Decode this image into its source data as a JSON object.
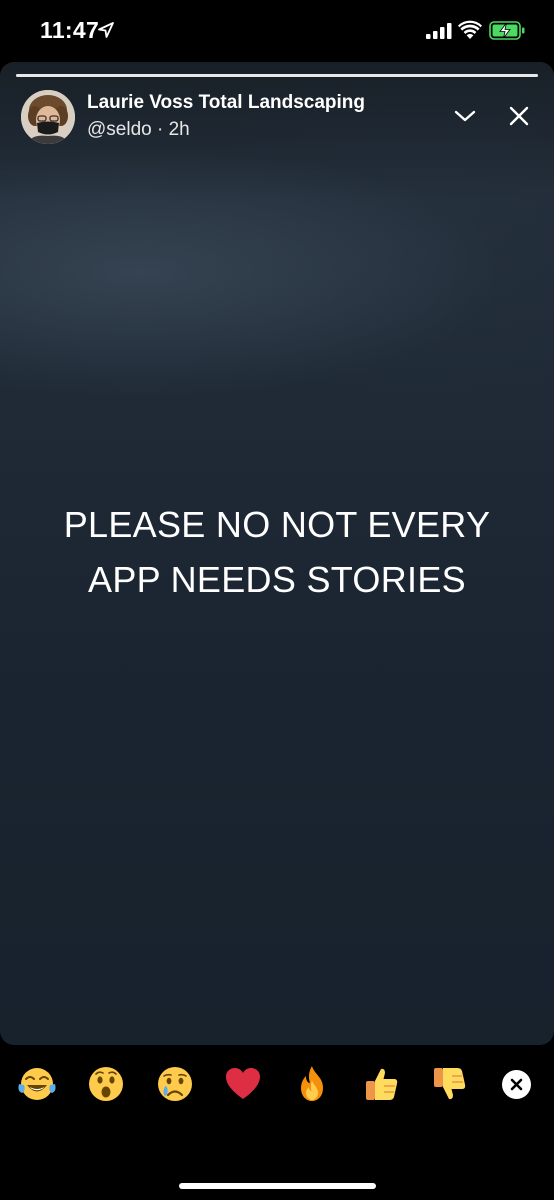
{
  "status_bar": {
    "time": "11:47",
    "location_icon": "location-arrow-icon",
    "signal_icon": "cellular-signal-icon",
    "wifi_icon": "wifi-icon",
    "battery_icon": "battery-charging-icon",
    "battery_color": "#4cd964"
  },
  "story": {
    "progress_fraction": 1.0,
    "author_name": "Laurie Voss Total Landscaping",
    "author_meta": "@seldo · 2h",
    "text_lines": [
      "PLEASE NO NOT EVERY",
      "APP NEEDS STORIES"
    ],
    "chevron_icon": "chevron-down-icon",
    "close_icon": "close-icon"
  },
  "reactions": {
    "items": [
      {
        "name": "tears-of-joy",
        "icon": "laughing-crying-emoji-icon"
      },
      {
        "name": "surprised",
        "icon": "surprised-face-emoji-icon"
      },
      {
        "name": "crying",
        "icon": "crying-face-emoji-icon"
      },
      {
        "name": "heart",
        "icon": "red-heart-emoji-icon"
      },
      {
        "name": "fire",
        "icon": "fire-emoji-icon"
      },
      {
        "name": "thumbs-up",
        "icon": "thumbs-up-emoji-icon"
      },
      {
        "name": "thumbs-down",
        "icon": "thumbs-down-emoji-icon"
      }
    ],
    "close_icon": "close-reactions-icon"
  },
  "colors": {
    "background": "#000000",
    "story_bg": "#1f2a36",
    "emoji_yellow": "#ffcb4c",
    "heart_red": "#dd2e44"
  }
}
